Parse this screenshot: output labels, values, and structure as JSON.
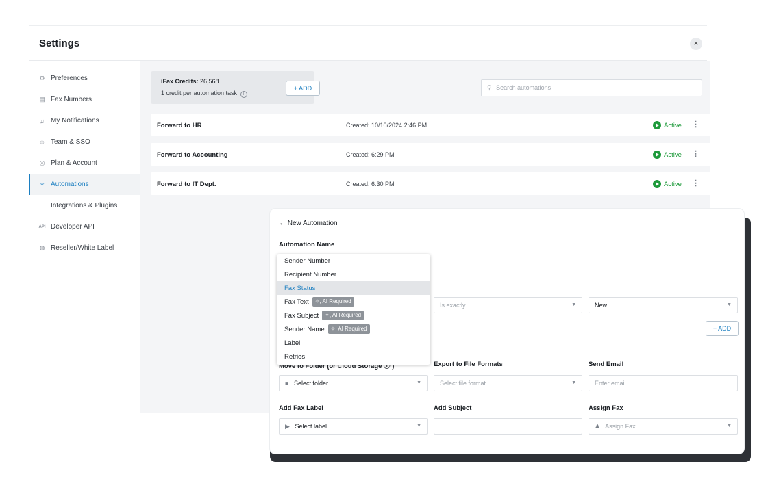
{
  "settings": {
    "title": "Settings",
    "close_icon": "×"
  },
  "sidebar": {
    "items": [
      {
        "label": "Preferences",
        "icon": "gear-icon",
        "glyph": "⚙"
      },
      {
        "label": "Fax Numbers",
        "icon": "fax-icon",
        "glyph": "▤"
      },
      {
        "label": "My Notifications",
        "icon": "bell-icon",
        "glyph": "♫"
      },
      {
        "label": "Team & SSO",
        "icon": "team-icon",
        "glyph": "☺"
      },
      {
        "label": "Plan & Account",
        "icon": "account-icon",
        "glyph": "◎"
      },
      {
        "label": "Automations",
        "icon": "sparkle-icon",
        "glyph": "✧"
      },
      {
        "label": "Integrations & Plugins",
        "icon": "grid-icon",
        "glyph": "⋮"
      },
      {
        "label": "Developer API",
        "icon": "api-icon",
        "glyph": "API"
      },
      {
        "label": "Reseller/White Label",
        "icon": "globe-icon",
        "glyph": "◍"
      }
    ]
  },
  "credits": {
    "label": "iFax Credits:",
    "value": "26,568",
    "note": "1 credit per automation task",
    "add_label": "+ ADD"
  },
  "search": {
    "placeholder": "Search automations",
    "icon": "search-icon"
  },
  "automations": [
    {
      "name": "Forward to HR",
      "created": "Created: 10/10/2024 2:46 PM",
      "status": "Active"
    },
    {
      "name": "Forward to Accounting",
      "created": "Created: 6:29 PM",
      "status": "Active"
    },
    {
      "name": "Forward to IT Dept.",
      "created": "Created: 6:30 PM",
      "status": "Active"
    }
  ],
  "panel": {
    "back_label": "← New Automation",
    "automation_name_label": "Automation Name",
    "condition_operator": "Is exactly",
    "condition_value": "New",
    "add_condition_label": "+ ADD",
    "move_to_folder_label": "Move to Folder (or Cloud Storage ⓘ )",
    "move_to_folder_value": "Select folder",
    "export_label": "Export to File Formats",
    "export_placeholder": "Select file format",
    "send_email_label": "Send Email",
    "send_email_placeholder": "Enter email",
    "fax_label_label": "Add Fax Label",
    "fax_label_value": "Select label",
    "subject_label": "Add Subject",
    "subject_value": "",
    "assign_label": "Assign Fax",
    "assign_value": "Assign Fax"
  },
  "dropdown": {
    "items": [
      {
        "label": "Sender Number",
        "badge": ""
      },
      {
        "label": "Recipient Number",
        "badge": ""
      },
      {
        "label": "Fax Status",
        "badge": ""
      },
      {
        "label": "Fax Text",
        "badge": "✧, AI Required"
      },
      {
        "label": "Fax Subject",
        "badge": "✧, AI Required"
      },
      {
        "label": "Sender Name",
        "badge": "✧, AI Required"
      },
      {
        "label": "Label",
        "badge": ""
      },
      {
        "label": "Retries",
        "badge": ""
      }
    ],
    "selected": "Fax Status"
  },
  "colors": {
    "accent": "#1c7fc1",
    "active_green": "#1e9a3b",
    "panel_shadow": "#2e3136"
  }
}
